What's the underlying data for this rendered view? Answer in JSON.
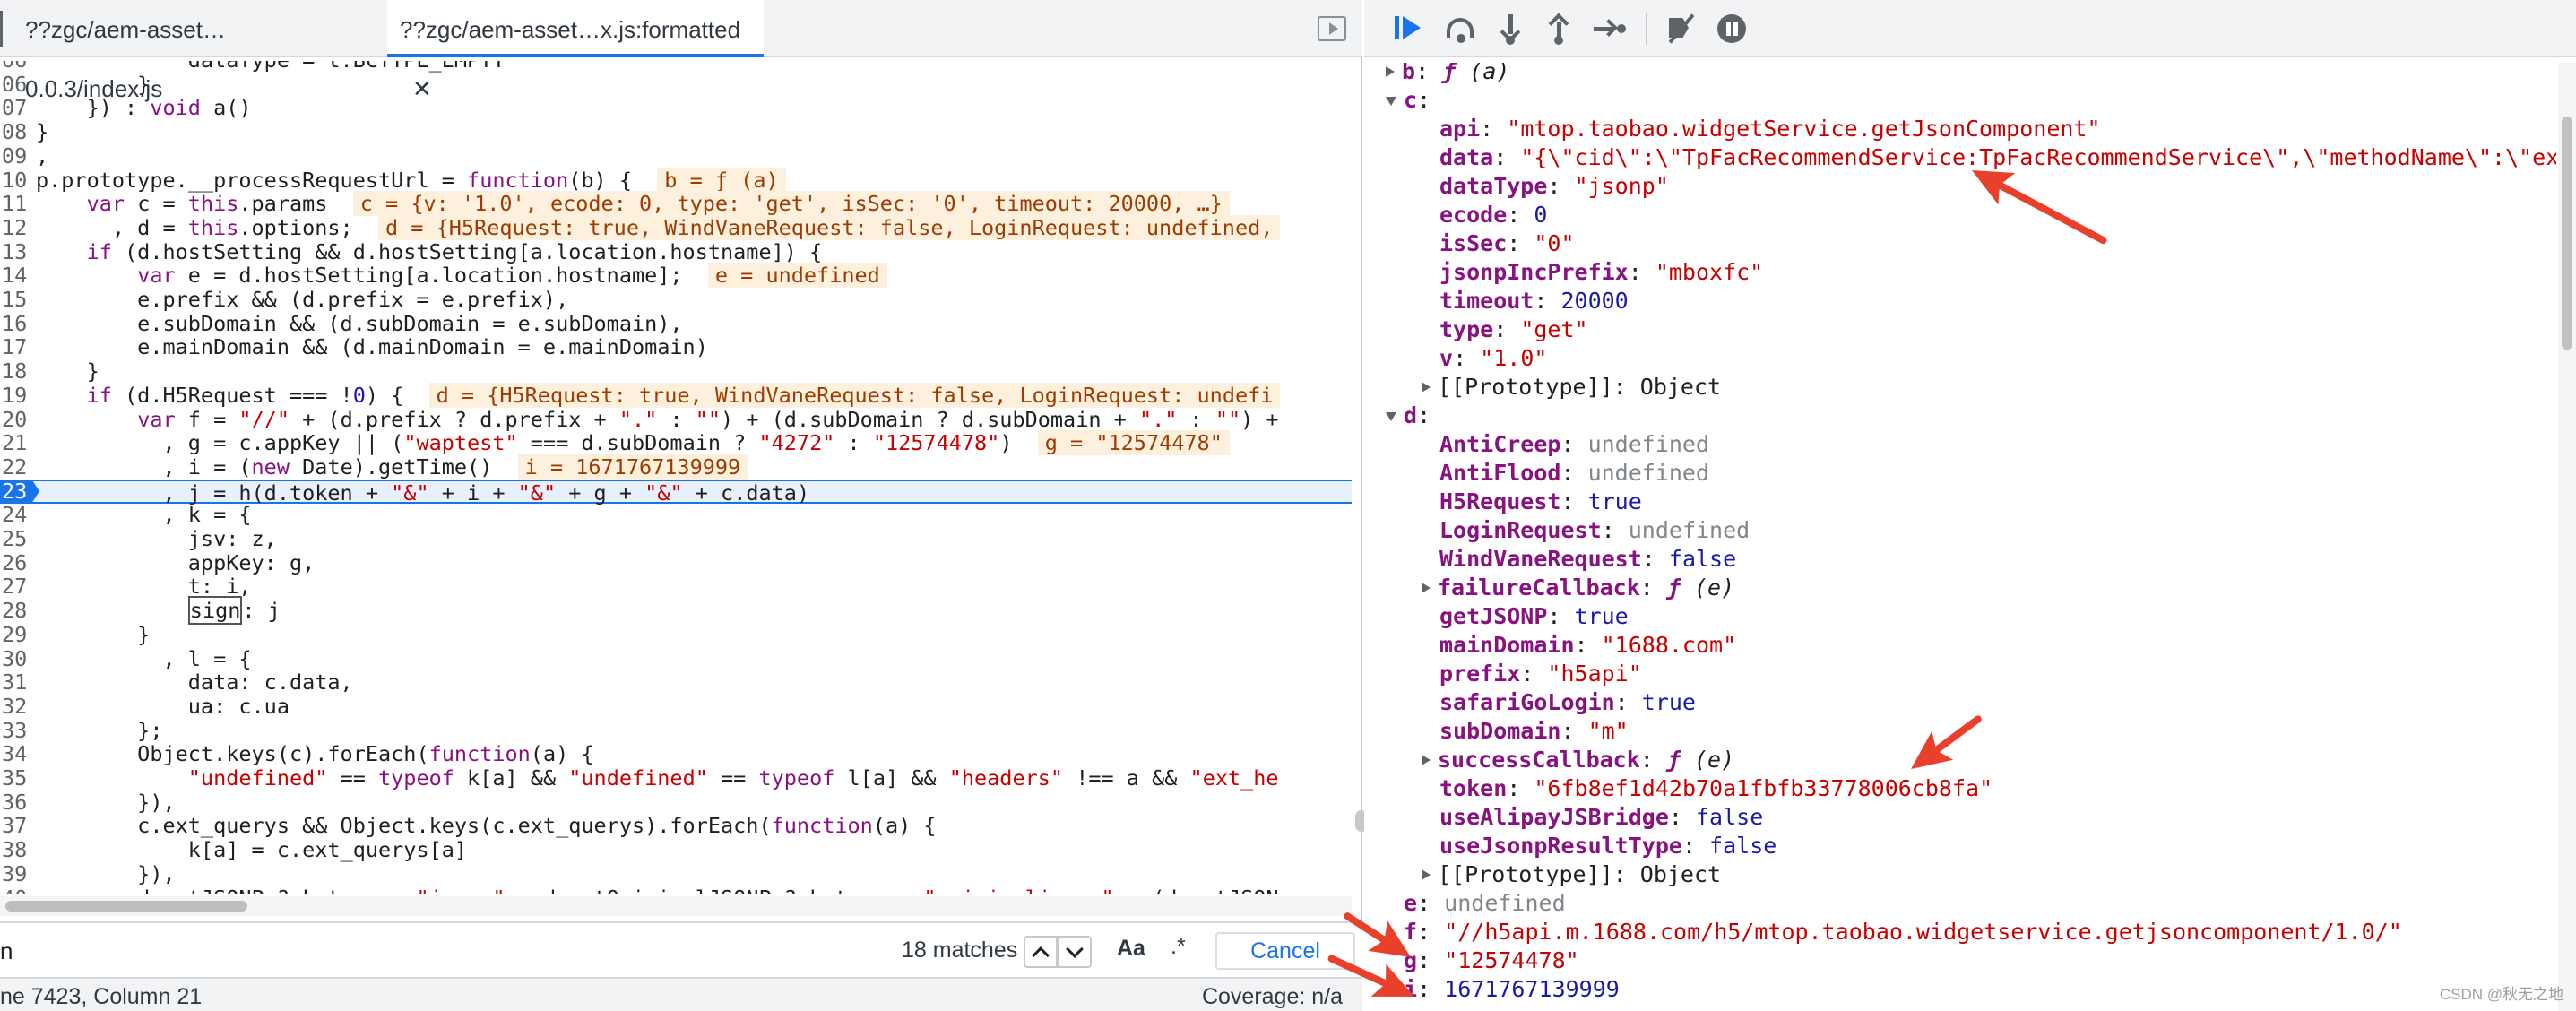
{
  "editor": {
    "tabs": [
      {
        "label": "??zgc/aem-asset…0.0.3/index.js"
      },
      {
        "label": "??zgc/aem-asset…x.js:formatted",
        "close": "✕"
      }
    ],
    "lines": [
      {
        "num": "06",
        "html": "            <span class='prop'>dataType</span> = t.BCTYPE_EMPTY"
      },
      {
        "num": "06",
        "html": "        }"
      },
      {
        "num": "07",
        "html": "    }) : <span class='kw'>void</span> a()"
      },
      {
        "num": "08",
        "html": "}"
      },
      {
        "num": "09",
        "html": ","
      },
      {
        "num": "10",
        "html": "p.prototype.__processRequestUrl = <span class='kw'>function</span>(b) {  <span class='inline-val'>b = ƒ (a)</span>"
      },
      {
        "num": "11",
        "html": "    <span class='kw'>var</span> c = <span class='kw'>this</span>.params  <span class='inline-val'>c = {v: '1.0', ecode: 0, type: 'get', isSec: '0', timeout: 20000, …}</span>"
      },
      {
        "num": "12",
        "html": "      , d = <span class='kw'>this</span>.options;  <span class='inline-val'>d = {H5Request: true, WindVaneRequest: false, LoginRequest: undefined,</span>"
      },
      {
        "num": "13",
        "html": "    <span class='kw'>if</span> (d.hostSetting &amp;&amp; d.hostSetting[a.location.hostname]) {"
      },
      {
        "num": "14",
        "html": "        <span class='kw'>var</span> e = d.hostSetting[a.location.hostname];  <span class='inline-val'>e = undefined</span>"
      },
      {
        "num": "15",
        "html": "        e.prefix &amp;&amp; (d.prefix = e.prefix),"
      },
      {
        "num": "16",
        "html": "        e.subDomain &amp;&amp; (d.subDomain = e.subDomain),"
      },
      {
        "num": "17",
        "html": "        e.mainDomain &amp;&amp; (d.mainDomain = e.mainDomain)"
      },
      {
        "num": "18",
        "html": "    }"
      },
      {
        "num": "19",
        "html": "    <span class='kw'>if</span> (d.H5Request === !<span class='num'>0</span>) {  <span class='inline-val'>d = {H5Request: true, WindVaneRequest: false, LoginRequest: undefi</span>"
      },
      {
        "num": "20",
        "html": "        <span class='kw'>var</span> f = <span class='str'>\"//\"</span> + (d.prefix ? d.prefix + <span class='str'>\".\"</span> : <span class='str'>\"\"</span>) + (d.subDomain ? d.subDomain + <span class='str'>\".\"</span> : <span class='str'>\"\"</span>) +"
      },
      {
        "num": "21",
        "html": "          , g = c.appKey || (<span class='str'>\"waptest\"</span> === d.subDomain ? <span class='str'>\"4272\"</span> : <span class='str'>\"12574478\"</span>)  <span class='inline-val'>g = \"12574478\"</span>"
      },
      {
        "num": "22",
        "html": "          , i = (<span class='kw'>new</span> Date).getTime()  <span class='inline-val'>i = 1671767139999</span>"
      },
      {
        "num": "23",
        "html": "          , j = h(d.token + <span class='str'>\"&amp;\"</span> + i + <span class='str'>\"&amp;\"</span> + g + <span class='str'>\"&amp;\"</span> + c.data)",
        "active": true
      },
      {
        "num": "24",
        "html": "          , k = {"
      },
      {
        "num": "25",
        "html": "            jsv: z,"
      },
      {
        "num": "26",
        "html": "            appKey: g,"
      },
      {
        "num": "27",
        "html": "            t: i,"
      },
      {
        "num": "28",
        "html": "            <span class='boxed'>sign</span>: j"
      },
      {
        "num": "29",
        "html": "        }"
      },
      {
        "num": "30",
        "html": "          , l = {"
      },
      {
        "num": "31",
        "html": "            data: c.data,"
      },
      {
        "num": "32",
        "html": "            ua: c.ua"
      },
      {
        "num": "33",
        "html": "        };"
      },
      {
        "num": "34",
        "html": "        Object.keys(c).forEach(<span class='kw'>function</span>(a) {"
      },
      {
        "num": "35",
        "html": "            <span class='str'>\"undefined\"</span> == <span class='kw'>typeof</span> k[a] &amp;&amp; <span class='str'>\"undefined\"</span> == <span class='kw'>typeof</span> l[a] &amp;&amp; <span class='str'>\"headers\"</span> !== a &amp;&amp; <span class='str'>\"ext_he</span>"
      },
      {
        "num": "36",
        "html": "        }),"
      },
      {
        "num": "37",
        "html": "        c.ext_querys &amp;&amp; Object.keys(c.ext_querys).forEach(<span class='kw'>function</span>(a) {"
      },
      {
        "num": "38",
        "html": "            k[a] = c.ext_querys[a]"
      },
      {
        "num": "39",
        "html": "        }),"
      },
      {
        "num": "40",
        "html": "        d.getJSONP ? k.type = <span class='str'>\"jsonp\"</span> : d.getOriginalJSONP ? k.type = <span class='str'>\"originaljsonp\"</span> : (d.getJSON"
      }
    ],
    "search": {
      "value": "n",
      "matches": "18 matches",
      "case_label": "Aa",
      "regex_label": ".*",
      "cancel_label": "Cancel"
    },
    "status": {
      "cursor": "ne 7423, Column 21",
      "coverage": "Coverage: n/a"
    }
  },
  "scope": {
    "rows": [
      {
        "indent": 0,
        "toggle": "r",
        "key": "b",
        "colon": ": ",
        "val": "ƒ (a)",
        "vtype": "fn",
        "keystyle": "key"
      },
      {
        "indent": 0,
        "toggle": "d",
        "key": "c",
        "colon": ":",
        "val": "",
        "vtype": "obj",
        "keystyle": "key"
      },
      {
        "indent": 1,
        "toggle": "",
        "key": "api",
        "colon": ": ",
        "val": "\"mtop.taobao.widgetService.getJsonComponent\"",
        "vtype": "str",
        "keystyle": "key"
      },
      {
        "indent": 1,
        "toggle": "",
        "key": "data",
        "colon": ": ",
        "val": "\"{\\\"cid\\\":\\\"TpFacRecommendService:TpFacRecommendService\\\",\\\"methodName\\\":\\\"execu",
        "vtype": "str",
        "keystyle": "key"
      },
      {
        "indent": 1,
        "toggle": "",
        "key": "dataType",
        "colon": ": ",
        "val": "\"jsonp\"",
        "vtype": "str",
        "keystyle": "key"
      },
      {
        "indent": 1,
        "toggle": "",
        "key": "ecode",
        "colon": ": ",
        "val": "0",
        "vtype": "num",
        "keystyle": "key"
      },
      {
        "indent": 1,
        "toggle": "",
        "key": "isSec",
        "colon": ": ",
        "val": "\"0\"",
        "vtype": "str",
        "keystyle": "key"
      },
      {
        "indent": 1,
        "toggle": "",
        "key": "jsonpIncPrefix",
        "colon": ": ",
        "val": "\"mboxfc\"",
        "vtype": "str",
        "keystyle": "key"
      },
      {
        "indent": 1,
        "toggle": "",
        "key": "timeout",
        "colon": ": ",
        "val": "20000",
        "vtype": "num",
        "keystyle": "key"
      },
      {
        "indent": 1,
        "toggle": "",
        "key": "type",
        "colon": ": ",
        "val": "\"get\"",
        "vtype": "str",
        "keystyle": "key"
      },
      {
        "indent": 1,
        "toggle": "",
        "key": "v",
        "colon": ": ",
        "val": "\"1.0\"",
        "vtype": "str",
        "keystyle": "key"
      },
      {
        "indent": 1,
        "toggle": "r",
        "key": "[[Prototype]]",
        "colon": ": ",
        "val": "Object",
        "vtype": "obj",
        "keystyle": "key-plain"
      },
      {
        "indent": 0,
        "toggle": "d",
        "key": "d",
        "colon": ":",
        "val": "",
        "vtype": "obj",
        "keystyle": "key"
      },
      {
        "indent": 1,
        "toggle": "",
        "key": "AntiCreep",
        "colon": ": ",
        "val": "undefined",
        "vtype": "undef",
        "keystyle": "key"
      },
      {
        "indent": 1,
        "toggle": "",
        "key": "AntiFlood",
        "colon": ": ",
        "val": "undefined",
        "vtype": "undef",
        "keystyle": "key"
      },
      {
        "indent": 1,
        "toggle": "",
        "key": "H5Request",
        "colon": ": ",
        "val": "true",
        "vtype": "bool",
        "keystyle": "key"
      },
      {
        "indent": 1,
        "toggle": "",
        "key": "LoginRequest",
        "colon": ": ",
        "val": "undefined",
        "vtype": "undef",
        "keystyle": "key"
      },
      {
        "indent": 1,
        "toggle": "",
        "key": "WindVaneRequest",
        "colon": ": ",
        "val": "false",
        "vtype": "bool",
        "keystyle": "key"
      },
      {
        "indent": 1,
        "toggle": "r",
        "key": "failureCallback",
        "colon": ": ",
        "val": "ƒ (e)",
        "vtype": "fn",
        "keystyle": "key"
      },
      {
        "indent": 1,
        "toggle": "",
        "key": "getJSONP",
        "colon": ": ",
        "val": "true",
        "vtype": "bool",
        "keystyle": "key"
      },
      {
        "indent": 1,
        "toggle": "",
        "key": "mainDomain",
        "colon": ": ",
        "val": "\"1688.com\"",
        "vtype": "str",
        "keystyle": "key"
      },
      {
        "indent": 1,
        "toggle": "",
        "key": "prefix",
        "colon": ": ",
        "val": "\"h5api\"",
        "vtype": "str",
        "keystyle": "key"
      },
      {
        "indent": 1,
        "toggle": "",
        "key": "safariGoLogin",
        "colon": ": ",
        "val": "true",
        "vtype": "bool",
        "keystyle": "key"
      },
      {
        "indent": 1,
        "toggle": "",
        "key": "subDomain",
        "colon": ": ",
        "val": "\"m\"",
        "vtype": "str",
        "keystyle": "key"
      },
      {
        "indent": 1,
        "toggle": "r",
        "key": "successCallback",
        "colon": ": ",
        "val": "ƒ (e)",
        "vtype": "fn",
        "keystyle": "key"
      },
      {
        "indent": 1,
        "toggle": "",
        "key": "token",
        "colon": ": ",
        "val": "\"6fb8ef1d42b70a1fbfb33778006cb8fa\"",
        "vtype": "str",
        "keystyle": "key"
      },
      {
        "indent": 1,
        "toggle": "",
        "key": "useAlipayJSBridge",
        "colon": ": ",
        "val": "false",
        "vtype": "bool",
        "keystyle": "key"
      },
      {
        "indent": 1,
        "toggle": "",
        "key": "useJsonpResultType",
        "colon": ": ",
        "val": "false",
        "vtype": "bool",
        "keystyle": "key"
      },
      {
        "indent": 1,
        "toggle": "r",
        "key": "[[Prototype]]",
        "colon": ": ",
        "val": "Object",
        "vtype": "obj",
        "keystyle": "key-plain"
      },
      {
        "indent": 0,
        "toggle": "",
        "key": "e",
        "colon": ": ",
        "val": "undefined",
        "vtype": "undef",
        "keystyle": "key"
      },
      {
        "indent": 0,
        "toggle": "",
        "key": "f",
        "colon": ": ",
        "val": "\"//h5api.m.1688.com/h5/mtop.taobao.widgetservice.getjsoncomponent/1.0/\"",
        "vtype": "str",
        "keystyle": "key"
      },
      {
        "indent": 0,
        "toggle": "",
        "key": "g",
        "colon": ": ",
        "val": "\"12574478\"",
        "vtype": "str",
        "keystyle": "key"
      },
      {
        "indent": 0,
        "toggle": "",
        "key": "i",
        "colon": ": ",
        "val": "1671767139999",
        "vtype": "num",
        "keystyle": "key"
      }
    ]
  },
  "watermark": "CSDN @秋无之地",
  "colors": {
    "accent": "#1a73e8",
    "annotation": "#e8402a",
    "inline_value_bg": "#fdf0dd"
  }
}
